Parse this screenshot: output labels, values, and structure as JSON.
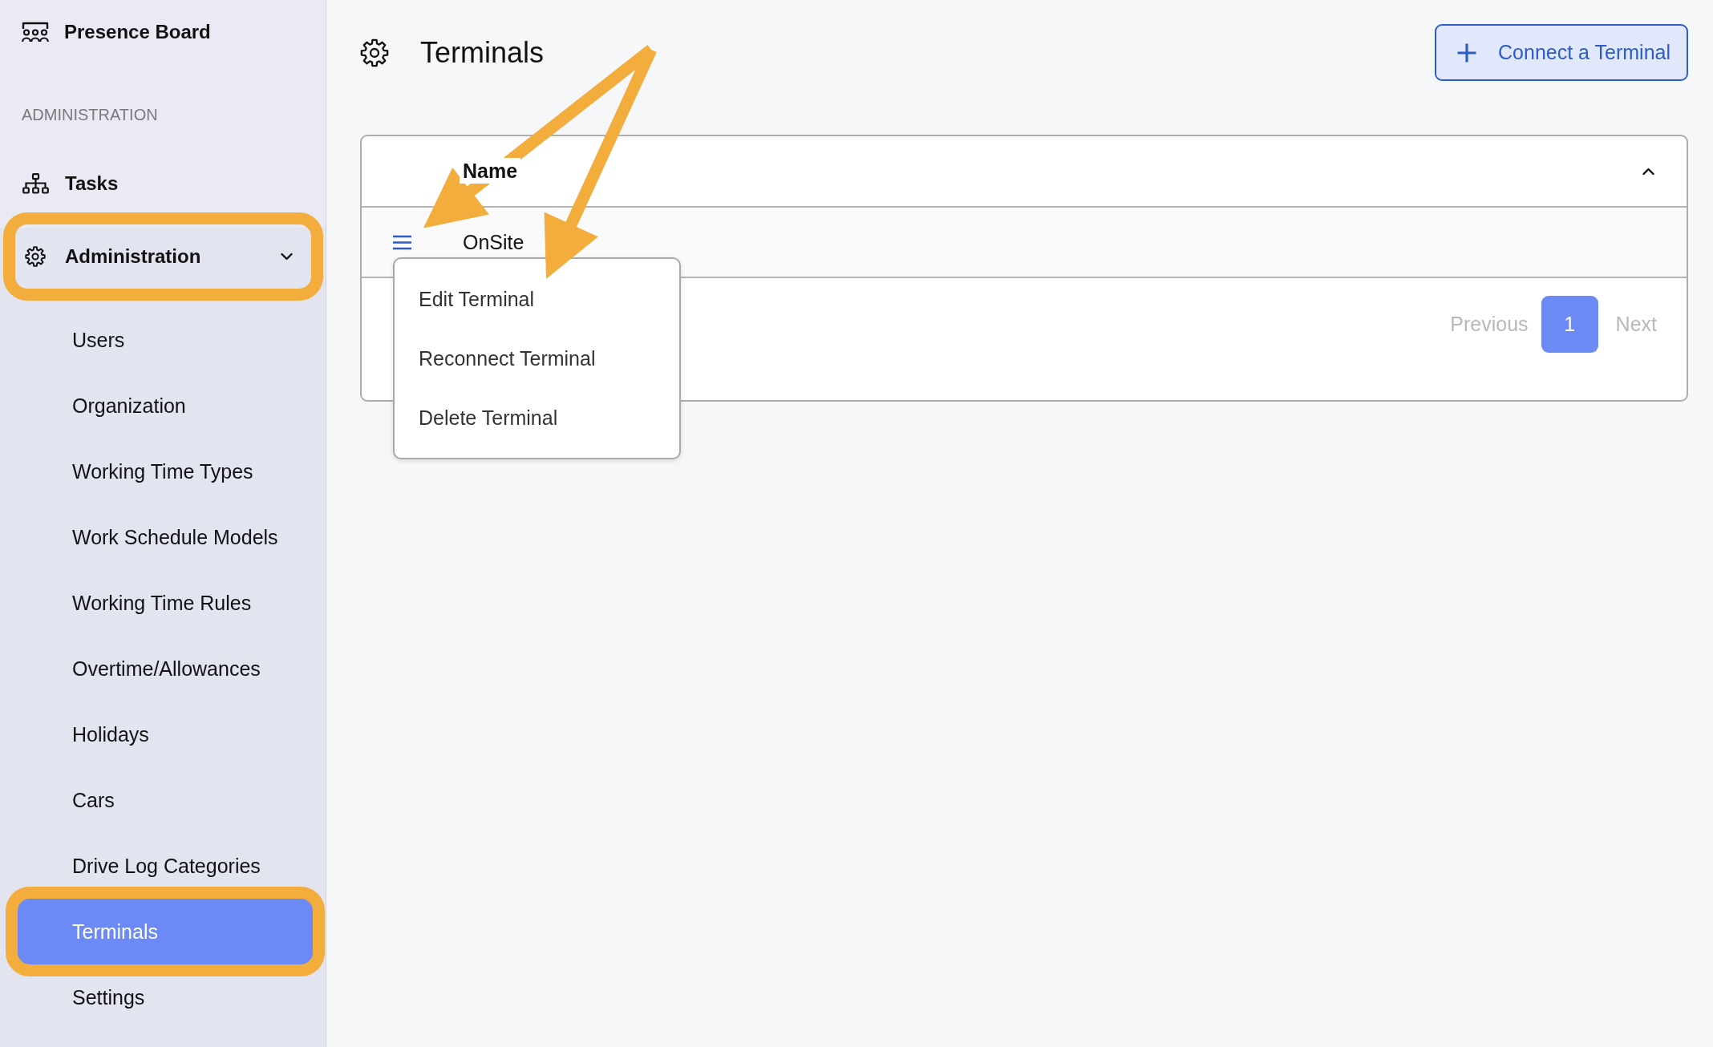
{
  "sidebar": {
    "app_title": "Presence Board",
    "section_label": "ADMINISTRATION",
    "items": [
      {
        "kind": "link",
        "label": "Tasks",
        "selected": false,
        "highlighted": false
      },
      {
        "kind": "group",
        "label": "Administration",
        "selected": false,
        "highlighted": true,
        "expanded": true,
        "children": [
          {
            "label": "Users",
            "selected": false,
            "highlighted": false
          },
          {
            "label": "Organization",
            "selected": false,
            "highlighted": false
          },
          {
            "label": "Working Time Types",
            "selected": false,
            "highlighted": false
          },
          {
            "label": "Work Schedule Models",
            "selected": false,
            "highlighted": false
          },
          {
            "label": "Working Time Rules",
            "selected": false,
            "highlighted": false
          },
          {
            "label": "Overtime/Allowances",
            "selected": false,
            "highlighted": false
          },
          {
            "label": "Holidays",
            "selected": false,
            "highlighted": false
          },
          {
            "label": "Cars",
            "selected": false,
            "highlighted": false
          },
          {
            "label": "Drive Log Categories",
            "selected": false,
            "highlighted": false
          },
          {
            "label": "Terminals",
            "selected": true,
            "highlighted": true
          },
          {
            "label": "Settings",
            "selected": false,
            "highlighted": false
          }
        ]
      }
    ]
  },
  "page": {
    "title": "Terminals",
    "primary_button": "Connect a Terminal"
  },
  "table": {
    "expanded": true,
    "columns": [
      {
        "label": "Name"
      }
    ],
    "rows": [
      {
        "cells": [
          "OnSite"
        ],
        "menu_button": {
          "pointed_at": true
        },
        "menu": {
          "open": true,
          "pointed_at": true,
          "items": [
            {
              "label": "Edit Terminal"
            },
            {
              "label": "Reconnect Terminal"
            },
            {
              "label": "Delete Terminal"
            }
          ]
        }
      }
    ]
  },
  "pagination": {
    "previous": {
      "label": "Previous",
      "disabled": true
    },
    "pages": [
      {
        "label": "1",
        "selected": true
      }
    ],
    "next": {
      "label": "Next",
      "disabled": true
    }
  }
}
